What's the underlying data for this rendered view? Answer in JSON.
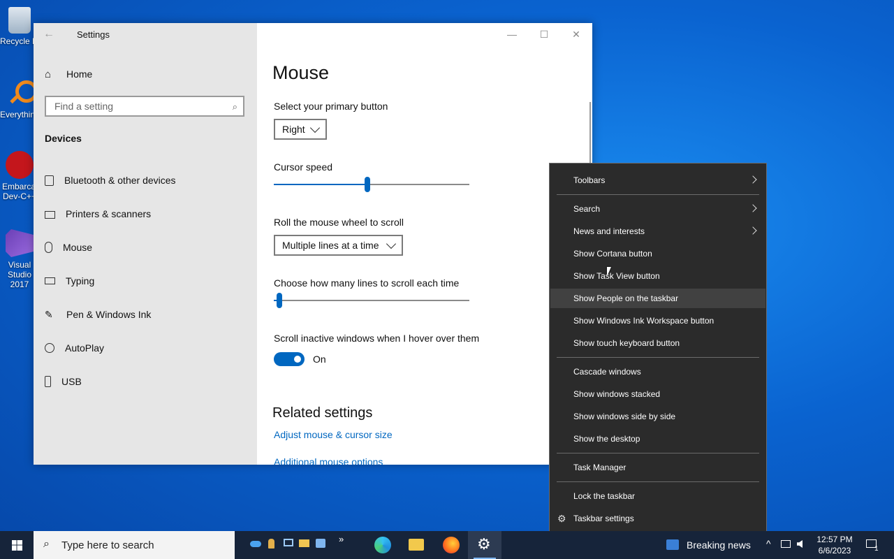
{
  "desktop": {
    "icons": [
      {
        "label": "Recycle Bin"
      },
      {
        "label": "Everything"
      },
      {
        "label": "Embarcadero Dev-C++"
      },
      {
        "label": "Visual Studio 2017"
      }
    ]
  },
  "settings": {
    "title": "Settings",
    "home": "Home",
    "search_placeholder": "Find a setting",
    "section": "Devices",
    "nav": [
      {
        "label": "Bluetooth & other devices",
        "icon": "bluetooth-devices-icon"
      },
      {
        "label": "Printers & scanners",
        "icon": "printer-icon"
      },
      {
        "label": "Mouse",
        "icon": "mouse-icon"
      },
      {
        "label": "Typing",
        "icon": "keyboard-icon"
      },
      {
        "label": "Pen & Windows Ink",
        "icon": "pen-icon"
      },
      {
        "label": "AutoPlay",
        "icon": "autoplay-icon"
      },
      {
        "label": "USB",
        "icon": "usb-icon"
      }
    ],
    "page_title": "Mouse",
    "primary_button_label": "Select your primary button",
    "primary_button_value": "Right",
    "cursor_speed_label": "Cursor speed",
    "cursor_speed_fraction": 0.48,
    "scroll_label": "Roll the mouse wheel to scroll",
    "scroll_value": "Multiple lines at a time",
    "lines_label": "Choose how many lines to scroll each time",
    "lines_fraction": 0.03,
    "inactive_label": "Scroll inactive windows when I hover over them",
    "inactive_state": "On",
    "related_title": "Related settings",
    "links": [
      "Adjust mouse & cursor size",
      "Additional mouse options"
    ]
  },
  "context_menu": {
    "items": [
      {
        "label": "Toolbars",
        "submenu": true
      },
      {
        "label": "Search",
        "submenu": true
      },
      {
        "label": "News and interests",
        "submenu": true
      },
      {
        "label": "Show Cortana button"
      },
      {
        "label": "Show Task View button"
      },
      {
        "label": "Show People on the taskbar",
        "highlighted": true
      },
      {
        "label": "Show Windows Ink Workspace button"
      },
      {
        "label": "Show touch keyboard button"
      },
      {
        "label": "Cascade windows"
      },
      {
        "label": "Show windows stacked"
      },
      {
        "label": "Show windows side by side"
      },
      {
        "label": "Show the desktop"
      },
      {
        "label": "Task Manager"
      },
      {
        "label": "Lock the taskbar"
      },
      {
        "label": "Taskbar settings"
      }
    ]
  },
  "taskbar": {
    "search_placeholder": "Type here to search",
    "overflow": "»",
    "news": "Breaking news",
    "time": "12:57 PM",
    "date": "6/6/2023",
    "notification_count": "1"
  },
  "colors": {
    "accent": "#0067c0",
    "taskbar": "#16243a",
    "menu": "#2b2b2b"
  }
}
